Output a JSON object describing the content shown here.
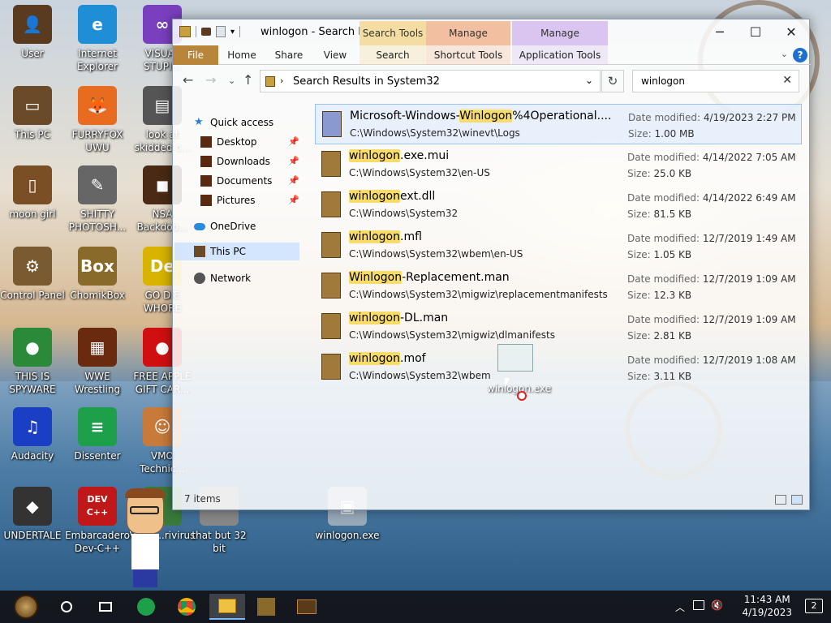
{
  "desktop": {
    "icons": [
      {
        "label": "User",
        "color": "#5a3b20",
        "glyph": "👤"
      },
      {
        "label": "Internet Explorer",
        "color": "#1e8fd6",
        "glyph": "e"
      },
      {
        "label": "VISUAL STUPI...",
        "color": "#7a3fbf",
        "glyph": "∞"
      },
      {
        "label": "This PC",
        "color": "#6b4a2a",
        "glyph": "▭"
      },
      {
        "label": "FURRYFOX UWU",
        "color": "#e86b1f",
        "glyph": "🦊"
      },
      {
        "label": "look at skidded c...",
        "color": "#555",
        "glyph": "▤"
      },
      {
        "label": "moon girl",
        "color": "#7a4f25",
        "glyph": "▯"
      },
      {
        "label": "SHITTY PHOTOSH...",
        "color": "#666",
        "glyph": "✎"
      },
      {
        "label": "NSA Backdoo...",
        "color": "#4a2a14",
        "glyph": "◼"
      },
      {
        "label": "Control Panel",
        "color": "#7a5a30",
        "glyph": "⚙"
      },
      {
        "label": "ChomikBox",
        "color": "#8a6a2a",
        "glyph": "Box"
      },
      {
        "label": "GO DIE WHORE",
        "color": "#d8b400",
        "glyph": "De"
      },
      {
        "label": "THIS IS SPYWARE",
        "color": "#2a8a3a",
        "glyph": "●"
      },
      {
        "label": "WWE Wrestling",
        "color": "#6a2a10",
        "glyph": "▦"
      },
      {
        "label": "FREE APPLE GIFT CAR...",
        "color": "#d01010",
        "glyph": "●"
      },
      {
        "label": "Audacity",
        "color": "#1a3ec4",
        "glyph": "♫"
      },
      {
        "label": "Dissenter",
        "color": "#1ea04a",
        "glyph": "≡"
      },
      {
        "label": "VMO Technic...",
        "color": "#c87a3a",
        "glyph": "☺"
      },
      {
        "label": "UNDERTALE",
        "color": "#333",
        "glyph": "◆"
      },
      {
        "label": "Embarcadero Dev-C++",
        "color": "#c01818",
        "glyph": "DEV C++"
      },
      {
        "label": "VMO ...rivirus",
        "color": "#3a7a3a",
        "glyph": ""
      },
      {
        "label": "that but 32 bit",
        "color": "#888",
        "glyph": ""
      },
      {
        "label": "winlogon.exe",
        "color": "#9ab",
        "glyph": "▣"
      }
    ]
  },
  "window": {
    "title": "winlogon - Search R...",
    "context_tab_search": "Search Tools",
    "context_tab_manage1": "Manage",
    "context_tab_manage2": "Manage",
    "ribbon_tabs": {
      "file": "File",
      "home": "Home",
      "share": "Share",
      "view": "View",
      "search": "Search",
      "shortcut_tools": "Shortcut Tools",
      "application_tools": "Application Tools"
    },
    "address": "Search Results in System32",
    "search_value": "winlogon",
    "nav": {
      "quick_access": "Quick access",
      "desktop": "Desktop",
      "downloads": "Downloads",
      "documents": "Documents",
      "pictures": "Pictures",
      "onedrive": "OneDrive",
      "this_pc": "This PC",
      "network": "Network"
    },
    "results": [
      {
        "pre": "Microsoft-Windows-",
        "hl": "Winlogon",
        "post": "%4Operational....",
        "path": "C:\\Windows\\System32\\winevt\\Logs",
        "date_label": "Date modified:",
        "date": "4/19/2023 2:27 PM",
        "size_label": "Size:",
        "size": "1.00 MB"
      },
      {
        "pre": "",
        "hl": "winlogon",
        "post": ".exe.mui",
        "path": "C:\\Windows\\System32\\en-US",
        "date_label": "Date modified:",
        "date": "4/14/2022 7:05 AM",
        "size_label": "Size:",
        "size": "25.0 KB"
      },
      {
        "pre": "",
        "hl": "winlogon",
        "post": "ext.dll",
        "path": "C:\\Windows\\System32",
        "date_label": "Date modified:",
        "date": "4/14/2022 6:49 AM",
        "size_label": "Size:",
        "size": "81.5 KB"
      },
      {
        "pre": "",
        "hl": "winlogon",
        "post": ".mfl",
        "path": "C:\\Windows\\System32\\wbem\\en-US",
        "date_label": "Date modified:",
        "date": "12/7/2019 1:49 AM",
        "size_label": "Size:",
        "size": "1.05 KB"
      },
      {
        "pre": "",
        "hl": "Winlogon",
        "post": "-Replacement.man",
        "path": "C:\\Windows\\System32\\migwiz\\replacementmanifests",
        "date_label": "Date modified:",
        "date": "12/7/2019 1:09 AM",
        "size_label": "Size:",
        "size": "12.3 KB"
      },
      {
        "pre": "",
        "hl": "winlogon",
        "post": "-DL.man",
        "path": "C:\\Windows\\System32\\migwiz\\dlmanifests",
        "date_label": "Date modified:",
        "date": "12/7/2019 1:09 AM",
        "size_label": "Size:",
        "size": "2.81 KB"
      },
      {
        "pre": "",
        "hl": "winlogon",
        "post": ".mof",
        "path": "C:\\Windows\\System32\\wbem",
        "date_label": "Date modified:",
        "date": "12/7/2019 1:08 AM",
        "size_label": "Size:",
        "size": "3.11 KB"
      }
    ],
    "status": "7 items",
    "drag_label": "winlogon.exe"
  },
  "taskbar": {
    "time": "11:43 AM",
    "date": "4/19/2023",
    "notification_count": "2",
    "accent": "#1e88e5"
  }
}
